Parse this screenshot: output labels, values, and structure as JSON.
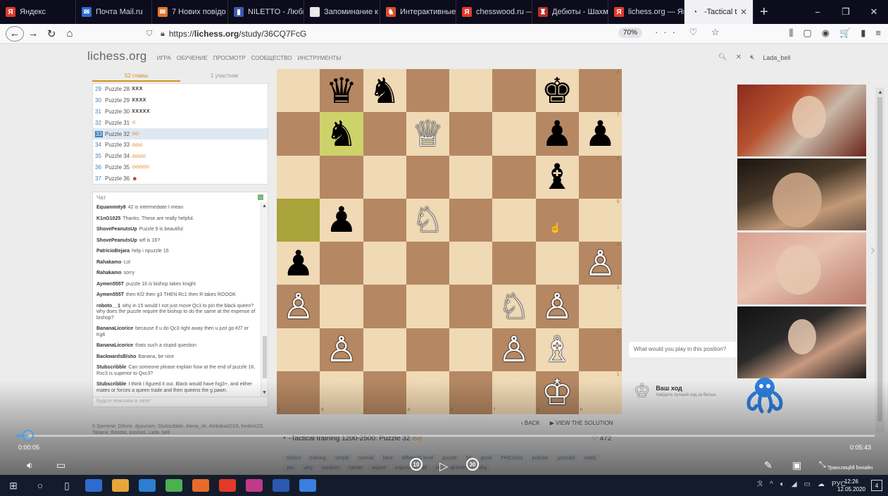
{
  "browser": {
    "tabs": [
      {
        "label": "Яндекс",
        "color": "#e23a2a",
        "glyph": "Я"
      },
      {
        "label": "Почта Mail.ru",
        "color": "#2d6bd0",
        "glyph": "✉"
      },
      {
        "label": "7 Нових повідо",
        "color": "#e0752a",
        "glyph": "✉"
      },
      {
        "label": "NILETTO - Люби",
        "color": "#3a5ab0",
        "glyph": "▮"
      },
      {
        "label": "Запоминание к",
        "color": "#e8e8e8",
        "glyph": "◔"
      },
      {
        "label": "Интерактивные",
        "color": "#d8502a",
        "glyph": "♞"
      },
      {
        "label": "chesswood.ru —",
        "color": "#e23a2a",
        "glyph": "Я"
      },
      {
        "label": "Дебюты - Шахм",
        "color": "#b8302a",
        "glyph": "♜"
      },
      {
        "label": "lichess.org — Ян",
        "color": "#e23a2a",
        "glyph": "Я"
      }
    ],
    "active_tab": {
      "label": "-Tactical t",
      "glyph": "◔"
    },
    "new_tab": "+",
    "window_controls": [
      "−",
      "❐",
      "✕"
    ],
    "url_protocol": "https://",
    "url_host": "lichess.org",
    "url_path": "/study/36CQ7FcG",
    "zoom": "70%",
    "url_actions": "··· ♡ ☆",
    "tools": [
      "⫼",
      "▢",
      "◉",
      "🛒",
      "▮",
      "≡"
    ]
  },
  "lichess": {
    "logo": "lichess.org",
    "menu": [
      "ИГРА",
      "ОБУЧЕНИЕ",
      "ПРОСМОТР",
      "СООБЩЕСТВО",
      "ИНСТРУМЕНТЫ"
    ],
    "username": "Lada_bell"
  },
  "study": {
    "tabs": [
      "52 главы",
      "1 участник"
    ],
    "chapters": [
      {
        "num": "29",
        "label": "Puzzle 28",
        "marks": "XXX",
        "fire": 0,
        "current": false
      },
      {
        "num": "30",
        "label": "Puzzle 29",
        "marks": "XXXX",
        "fire": 0,
        "current": false
      },
      {
        "num": "31",
        "label": "Puzzle 30",
        "marks": "XXXXX",
        "fire": 0,
        "current": false
      },
      {
        "num": "32",
        "label": "Puzzle 31",
        "marks": "",
        "fire": 1,
        "current": false
      },
      {
        "num": "33",
        "label": "Puzzle 32",
        "marks": "",
        "fire": 2,
        "current": true
      },
      {
        "num": "34",
        "label": "Puzzle 33",
        "marks": "",
        "fire": 3,
        "current": false
      },
      {
        "num": "35",
        "label": "Puzzle 34",
        "marks": "",
        "fire": 4,
        "current": false
      },
      {
        "num": "36",
        "label": "Puzzle 35",
        "marks": "",
        "fire": 5,
        "current": false
      },
      {
        "num": "37",
        "label": "Puzzle 36",
        "marks": "",
        "fire": 0,
        "devil": true,
        "current": false
      }
    ],
    "chat_title": "Чат",
    "chat_placeholder": "Будьте вежливы в чате!",
    "messages": [
      {
        "user": "Equanimity8",
        "text": "42 is intermediate I mean"
      },
      {
        "user": "K1nG1025",
        "text": "Thanks. These are really helpful."
      },
      {
        "user": "ShovePeanutsUp",
        "text": "Puzzle 9 is beautiful"
      },
      {
        "user": "ShovePeanutsUp",
        "text": "wtf is 16?"
      },
      {
        "user": "PatricioBejara",
        "text": "help i npuzzle 16"
      },
      {
        "user": "Rahakamo",
        "text": "Lol"
      },
      {
        "user": "Rahakamo",
        "text": "sorry"
      },
      {
        "user": "Aymen555T",
        "text": "puzzle 16 is bishop takes knight"
      },
      {
        "user": "Aymen555T",
        "text": "then Kf2 then g3 THEN Rc1 then R takes ROOOK"
      },
      {
        "user": "roboto__1",
        "text": "why in 15 would I not just move Qc3 to pin the black queen? why does the puzzle require the bishop to do the same at the expense of bishop?"
      },
      {
        "user": "BananaLicorice",
        "text": "because if u do Qc3 right away then u just go Kf7 or Kg6"
      },
      {
        "user": "BananaLicorice",
        "text": "thats such a stupid question"
      },
      {
        "user": "BackwardsBlsho",
        "text": "Banana, be nice"
      },
      {
        "user": "Stubscribble",
        "text": "Can someone please explain how at the end of puzzle 16, Rxc3 is superior to Qxc3?"
      },
      {
        "user": "Stubscribble",
        "text": "I think I figured it out. Black would have fxg3+, and either mates or forces a queen trade and then queens the g pawn."
      }
    ],
    "spectators": "9 Зрители: Difone, djuiunum, Stubscibble, Alena_str, Alekakia2019, frederic22, Tatiana_Bondar, procket, Lada_bell",
    "back_label": "BACK",
    "solution_label": "VIEW THE SOLUTION",
    "title": "-Tactical training 1200-2500: Puzzle 32",
    "likes": "472",
    "tags": [
      "tactics",
      "training",
      "simple",
      "normal",
      "hard",
      "differents level",
      "puzzle",
      "50",
      "good",
      "PhilChess",
      "popular",
      "youtube",
      "really",
      "yes",
      "very",
      "medium",
      "harder",
      "expert",
      "improve",
      "all",
      "ok",
      "all levels",
      "why"
    ],
    "prompt": "What would you play in this position?",
    "your_move": "Ваш ход",
    "your_move_hint": "Найдите лучший ход за белых."
  },
  "board": {
    "files": [
      "a",
      "b",
      "c",
      "d",
      "e",
      "f",
      "g",
      "h"
    ],
    "ranks": [
      "8",
      "7",
      "6",
      "5",
      "4",
      "3",
      "2",
      "1"
    ],
    "highlights": [
      "b7",
      "a5"
    ],
    "pieces": [
      {
        "sq": "b8",
        "glyph": "♛",
        "color": "b"
      },
      {
        "sq": "c8",
        "glyph": "♞",
        "color": "b"
      },
      {
        "sq": "g8",
        "glyph": "♚",
        "color": "b"
      },
      {
        "sq": "b7",
        "glyph": "♞",
        "color": "b"
      },
      {
        "sq": "d7",
        "glyph": "♕",
        "color": "w"
      },
      {
        "sq": "g7",
        "glyph": "♟",
        "color": "b"
      },
      {
        "sq": "h7",
        "glyph": "♟",
        "color": "b"
      },
      {
        "sq": "g6",
        "glyph": "♝",
        "color": "b"
      },
      {
        "sq": "b5",
        "glyph": "♟",
        "color": "b"
      },
      {
        "sq": "d5",
        "glyph": "♘",
        "color": "w"
      },
      {
        "sq": "a4",
        "glyph": "♟",
        "color": "b"
      },
      {
        "sq": "h4",
        "glyph": "♙",
        "color": "w"
      },
      {
        "sq": "a3",
        "glyph": "♙",
        "color": "w"
      },
      {
        "sq": "f3",
        "glyph": "♘",
        "color": "w"
      },
      {
        "sq": "g3",
        "glyph": "♙",
        "color": "w"
      },
      {
        "sq": "b2",
        "glyph": "♙",
        "color": "w"
      },
      {
        "sq": "f2",
        "glyph": "♙",
        "color": "w"
      },
      {
        "sq": "g2",
        "glyph": "♗",
        "color": "w"
      },
      {
        "sq": "g1",
        "glyph": "♔",
        "color": "w"
      }
    ]
  },
  "video": {
    "current_time": "0:00:05",
    "total_time": "0:05:43",
    "progress": 0.015,
    "skip_back": "10",
    "skip_forward": "30",
    "online_label": "Трансляция онлайн"
  },
  "taskbar": {
    "apps": [
      {
        "color": "#2d6bd0"
      },
      {
        "color": "#e8a53a"
      },
      {
        "color": "#2a7fd0"
      },
      {
        "color": "#4ab050"
      },
      {
        "color": "#e86a2a"
      },
      {
        "color": "#e23a2a"
      },
      {
        "color": "#c03a8a"
      },
      {
        "color": "#2a5ab0"
      },
      {
        "color": "#3a7fe0"
      }
    ],
    "lang": "РУС",
    "time": "12:26",
    "date": "12.05.2020",
    "notifications": "4"
  }
}
